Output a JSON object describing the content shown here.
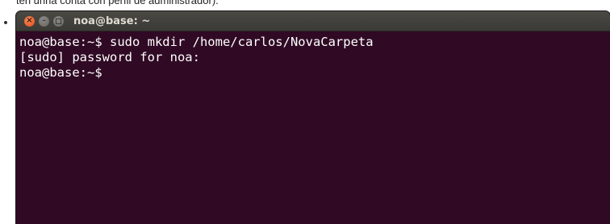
{
  "page": {
    "caption": "ten unha conta con perfil de administrador)."
  },
  "window": {
    "title": "noa@base: ~",
    "buttons": {
      "close": "×",
      "minimize": "–"
    }
  },
  "terminal": {
    "lines": [
      "noa@base:~$ sudo mkdir /home/carlos/NovaCarpeta",
      "[sudo] password for noa:",
      "noa@base:~$"
    ]
  },
  "colors": {
    "terminal_background": "#300a24",
    "titlebar": "#3c3b37",
    "close_button": "#df4a16",
    "text": "#ffffff"
  }
}
